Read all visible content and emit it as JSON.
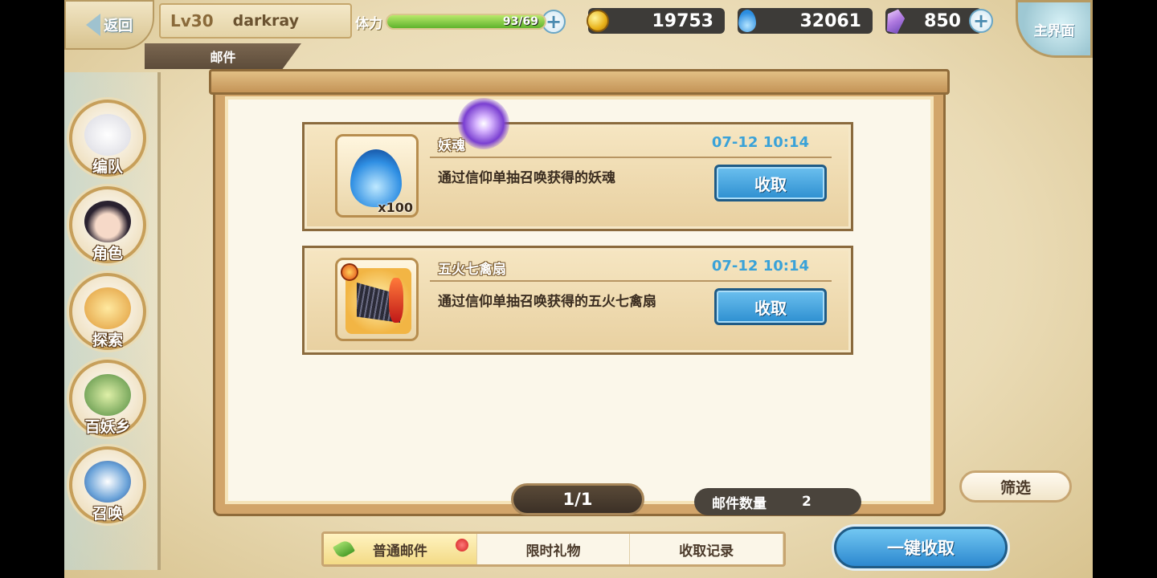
{
  "header": {
    "back_label": "返回",
    "level": "Lv30",
    "player_name": "darkray",
    "section_tab": "邮件",
    "stamina_label": "体力",
    "stamina_text": "93/69",
    "stamina_fill": 1.0,
    "gold": "19753",
    "soul": "32061",
    "crystal": "850",
    "home_label": "主界面"
  },
  "sidebar": {
    "items": [
      {
        "label": "编队",
        "icon": "team-icon"
      },
      {
        "label": "角色",
        "icon": "character-icon"
      },
      {
        "label": "探索",
        "icon": "explore-icon"
      },
      {
        "label": "百妖乡",
        "icon": "village-icon"
      },
      {
        "label": "召唤",
        "icon": "summon-icon"
      }
    ]
  },
  "mails": [
    {
      "title": "妖魂",
      "time": "07-12 10:14",
      "desc": "通过信仰单抽召唤获得的妖魂",
      "qty": "x100",
      "claim": "收取",
      "icon": "blue-soul-flame-icon"
    },
    {
      "title": "五火七禽扇",
      "time": "07-12 10:14",
      "desc": "通过信仰单抽召唤获得的五火七禽扇",
      "qty": "",
      "claim": "收取",
      "icon": "fire-fan-icon"
    }
  ],
  "footer": {
    "page": "1/1",
    "count_label": "邮件数量",
    "count_value": "2",
    "filter": "筛选",
    "tabs": [
      "普通邮件",
      "限时礼物",
      "收取记录"
    ],
    "collect_all": "一键收取"
  },
  "colors": {
    "accent_blue": "#2d8fd0",
    "time_blue": "#3aa2d8",
    "frame_brown": "#8a6a3d"
  }
}
